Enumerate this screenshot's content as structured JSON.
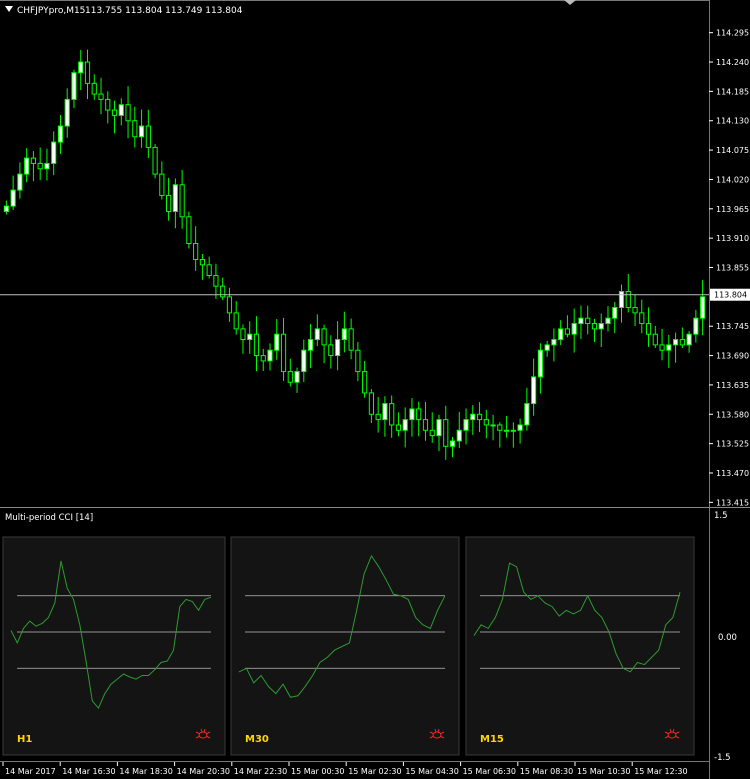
{
  "header": {
    "symbol": "CHFJPYpro,M15",
    "ohlc": "113.755 113.804 113.749 113.804"
  },
  "colors": {
    "background": "#000000",
    "bull_candle": "#ffffff",
    "bear_candle": "#000000",
    "wick": "#00ff00",
    "price_line": "#c0c0c0",
    "axis_text": "#ffffff",
    "cci_line": "#2e9a2e",
    "panel_bg": "#141414",
    "period_label": "#ffd700",
    "alert_icon": "#ff2020"
  },
  "indicator": {
    "title": "Multi-period CCI [14]",
    "scale": [
      "1.5",
      "0.00",
      "-1.5"
    ],
    "panels": [
      {
        "label": "H1",
        "icon": "bug-alert-icon"
      },
      {
        "label": "M30",
        "icon": "bug-alert-icon"
      },
      {
        "label": "M15",
        "icon": "bug-alert-icon"
      }
    ]
  },
  "chart_data": [
    {
      "type": "candlestick",
      "title": "CHFJPYpro,M15",
      "ylim": [
        113.41,
        114.33
      ],
      "y_ticks": [
        "114.295",
        "114.240",
        "114.185",
        "114.130",
        "114.075",
        "114.020",
        "113.965",
        "113.910",
        "113.855",
        "113.745",
        "113.690",
        "113.635",
        "113.580",
        "113.525",
        "113.470",
        "113.415"
      ],
      "current_price": "113.804",
      "x_labels": [
        "14 Mar 2017",
        "14 Mar 16:30",
        "14 Mar 18:30",
        "14 Mar 20:30",
        "14 Mar 22:30",
        "15 Mar 00:30",
        "15 Mar 02:30",
        "15 Mar 04:30",
        "15 Mar 06:30",
        "15 Mar 08:30",
        "15 Mar 10:30",
        "15 Mar 12:30"
      ],
      "close_path": [
        113.97,
        114.0,
        114.03,
        114.06,
        114.05,
        114.04,
        114.05,
        114.09,
        114.12,
        114.17,
        114.22,
        114.24,
        114.2,
        114.18,
        114.17,
        114.15,
        114.14,
        114.16,
        114.13,
        114.1,
        114.12,
        114.08,
        114.03,
        113.99,
        113.96,
        114.01,
        113.95,
        113.9,
        113.87,
        113.86,
        113.84,
        113.82,
        113.8,
        113.77,
        113.74,
        113.72,
        113.73,
        113.69,
        113.68,
        113.7,
        113.73,
        113.66,
        113.64,
        113.66,
        113.7,
        113.72,
        113.74,
        113.71,
        113.69,
        113.72,
        113.74,
        113.7,
        113.66,
        113.62,
        113.58,
        113.57,
        113.6,
        113.56,
        113.55,
        113.57,
        113.59,
        113.57,
        113.55,
        113.54,
        113.57,
        113.52,
        113.53,
        113.55,
        113.57,
        113.58,
        113.57,
        113.56,
        113.56,
        113.55,
        113.55,
        113.55,
        113.56,
        113.6,
        113.65,
        113.7,
        113.71,
        113.72,
        113.74,
        113.73,
        113.75,
        113.76,
        113.75,
        113.74,
        113.75,
        113.76,
        113.78,
        113.81,
        113.78,
        113.77,
        113.75,
        113.73,
        113.71,
        113.7,
        113.71,
        113.72,
        113.71,
        113.73,
        113.76,
        113.8
      ]
    },
    {
      "type": "line",
      "title": "H1",
      "ylim": [
        -1.5,
        1.5
      ],
      "levels": [
        0.5,
        0,
        -0.5
      ],
      "values": [
        0.02,
        -0.15,
        0.05,
        0.15,
        0.08,
        0.12,
        0.2,
        0.4,
        0.98,
        0.6,
        0.45,
        0.1,
        -0.4,
        -0.95,
        -1.05,
        -0.85,
        -0.72,
        -0.65,
        -0.58,
        -0.62,
        -0.65,
        -0.6,
        -0.6,
        -0.52,
        -0.42,
        -0.4,
        -0.25,
        0.35,
        0.45,
        0.42,
        0.3,
        0.45,
        0.48
      ]
    },
    {
      "type": "line",
      "title": "M30",
      "ylim": [
        -1.5,
        1.5
      ],
      "levels": [
        0.5,
        0,
        -0.5
      ],
      "values": [
        -0.55,
        -0.5,
        -0.7,
        -0.6,
        -0.75,
        -0.85,
        -0.72,
        -0.9,
        -0.88,
        -0.75,
        -0.6,
        -0.42,
        -0.35,
        -0.25,
        -0.2,
        -0.15,
        0.3,
        0.8,
        1.05,
        0.9,
        0.72,
        0.52,
        0.5,
        0.45,
        0.2,
        0.1,
        0.05,
        0.3,
        0.5
      ]
    },
    {
      "type": "line",
      "title": "M15",
      "ylim": [
        -1.5,
        1.5
      ],
      "levels": [
        0.5,
        0,
        -0.5
      ],
      "values": [
        -0.05,
        0.1,
        0.05,
        0.2,
        0.45,
        0.95,
        0.9,
        0.55,
        0.45,
        0.5,
        0.4,
        0.35,
        0.22,
        0.3,
        0.25,
        0.3,
        0.5,
        0.3,
        0.2,
        0.0,
        -0.3,
        -0.5,
        -0.55,
        -0.42,
        -0.45,
        -0.35,
        -0.25,
        0.1,
        0.2,
        0.55
      ]
    }
  ]
}
